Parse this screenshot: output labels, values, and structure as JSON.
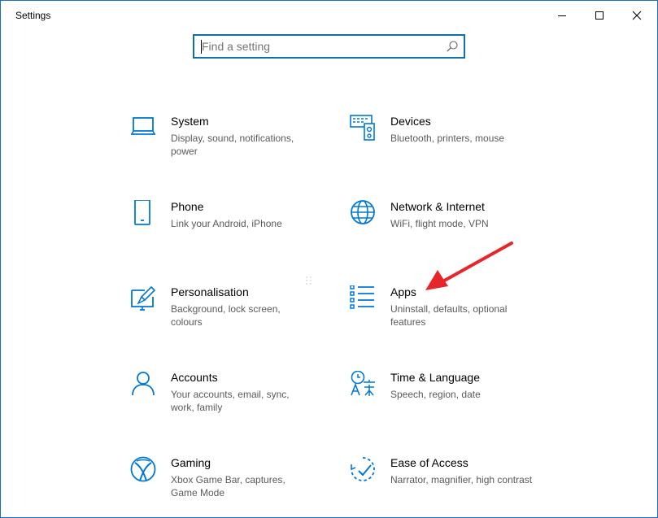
{
  "window": {
    "title": "Settings"
  },
  "search": {
    "placeholder": "Find a setting"
  },
  "tiles": [
    {
      "name": "System",
      "desc": "Display, sound, notifications, power",
      "icon": "laptop-icon"
    },
    {
      "name": "Devices",
      "desc": "Bluetooth, printers, mouse",
      "icon": "devices-icon"
    },
    {
      "name": "Phone",
      "desc": "Link your Android, iPhone",
      "icon": "phone-icon"
    },
    {
      "name": "Network & Internet",
      "desc": "WiFi, flight mode, VPN",
      "icon": "globe-icon"
    },
    {
      "name": "Personalisation",
      "desc": "Background, lock screen, colours",
      "icon": "paint-icon"
    },
    {
      "name": "Apps",
      "desc": "Uninstall, defaults, optional features",
      "icon": "apps-list-icon"
    },
    {
      "name": "Accounts",
      "desc": "Your accounts, email, sync, work, family",
      "icon": "person-icon"
    },
    {
      "name": "Time & Language",
      "desc": "Speech, region, date",
      "icon": "time-language-icon"
    },
    {
      "name": "Gaming",
      "desc": "Xbox Game Bar, captures, Game Mode",
      "icon": "xbox-icon"
    },
    {
      "name": "Ease of Access",
      "desc": "Narrator, magnifier, high contrast",
      "icon": "ease-of-access-icon"
    }
  ],
  "colors": {
    "accent": "#0078d7",
    "annotation": "#e8262a",
    "border": "#1a6fc4"
  }
}
